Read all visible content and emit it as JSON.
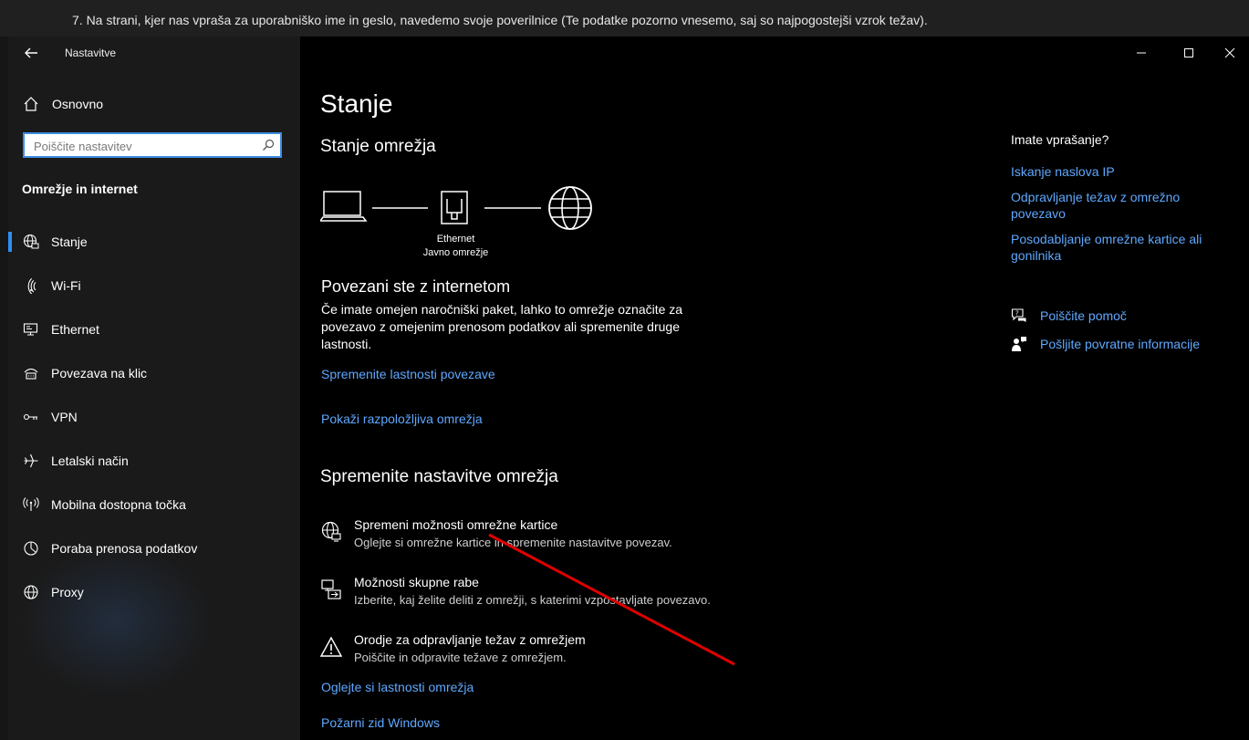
{
  "document": {
    "instruction": "7. Na strani, kjer nas vpraša za uporabniško ime in geslo, navedemo svoje poverilnice (Te podatke pozorno vnesemo, saj so najpogostejši vzrok težav)."
  },
  "sidebar": {
    "app_title": "Nastavitve",
    "home_label": "Osnovno",
    "search_placeholder": "Poiščite nastavitev",
    "section_title": "Omrežje in internet",
    "items": [
      {
        "label": "Stanje",
        "icon": "globe-status-icon",
        "selected": true
      },
      {
        "label": "Wi-Fi",
        "icon": "wifi-icon"
      },
      {
        "label": "Ethernet",
        "icon": "ethernet-icon"
      },
      {
        "label": "Povezava na klic",
        "icon": "dial-up-icon"
      },
      {
        "label": "VPN",
        "icon": "vpn-icon"
      },
      {
        "label": "Letalski način",
        "icon": "airplane-icon"
      },
      {
        "label": "Mobilna dostopna točka",
        "icon": "hotspot-icon"
      },
      {
        "label": "Poraba prenosa podatkov",
        "icon": "data-usage-icon"
      },
      {
        "label": "Proxy",
        "icon": "globe-icon"
      }
    ]
  },
  "main": {
    "title": "Stanje",
    "network_status_heading": "Stanje omrežja",
    "diagram": {
      "connection_name": "Ethernet",
      "network_type": "Javno omrežje"
    },
    "connected_title": "Povezani ste z internetom",
    "connected_desc": "Če imate omejen naročniški paket, lahko to omrežje označite za povezavo z omejenim prenosom podatkov ali spremenite druge lastnosti.",
    "link_change_props": "Spremenite lastnosti povezave",
    "link_show_networks": "Pokaži razpoložljiva omrežja",
    "change_settings_heading": "Spremenite nastavitve omrežja",
    "options": [
      {
        "title": "Spremeni možnosti omrežne kartice",
        "desc": "Oglejte si omrežne kartice in spremenite nastavitve povezav.",
        "icon": "adapter-icon"
      },
      {
        "title": "Možnosti skupne rabe",
        "desc": "Izberite, kaj želite deliti z omrežji, s katerimi vzpostavljate povezavo.",
        "icon": "sharing-icon"
      },
      {
        "title": "Orodje za odpravljanje težav z omrežjem",
        "desc": "Poiščite in odpravite težave z omrežjem.",
        "icon": "warning-icon"
      }
    ],
    "link_view_props": "Oglejte si lastnosti omrežja",
    "link_firewall": "Požarni zid Windows"
  },
  "help": {
    "heading": "Imate vprašanje?",
    "links": [
      "Iskanje naslova IP",
      "Odpravljanje težav z omrežno povezavo",
      "Posodabljanje omrežne kartice ali gonilnika"
    ],
    "get_help": "Poiščite pomoč",
    "feedback": "Pošljite povratne informacije"
  },
  "colors": {
    "accent": "#2f8ff0",
    "link": "#5fa8ff",
    "annotation_arrow": "#e00000"
  }
}
